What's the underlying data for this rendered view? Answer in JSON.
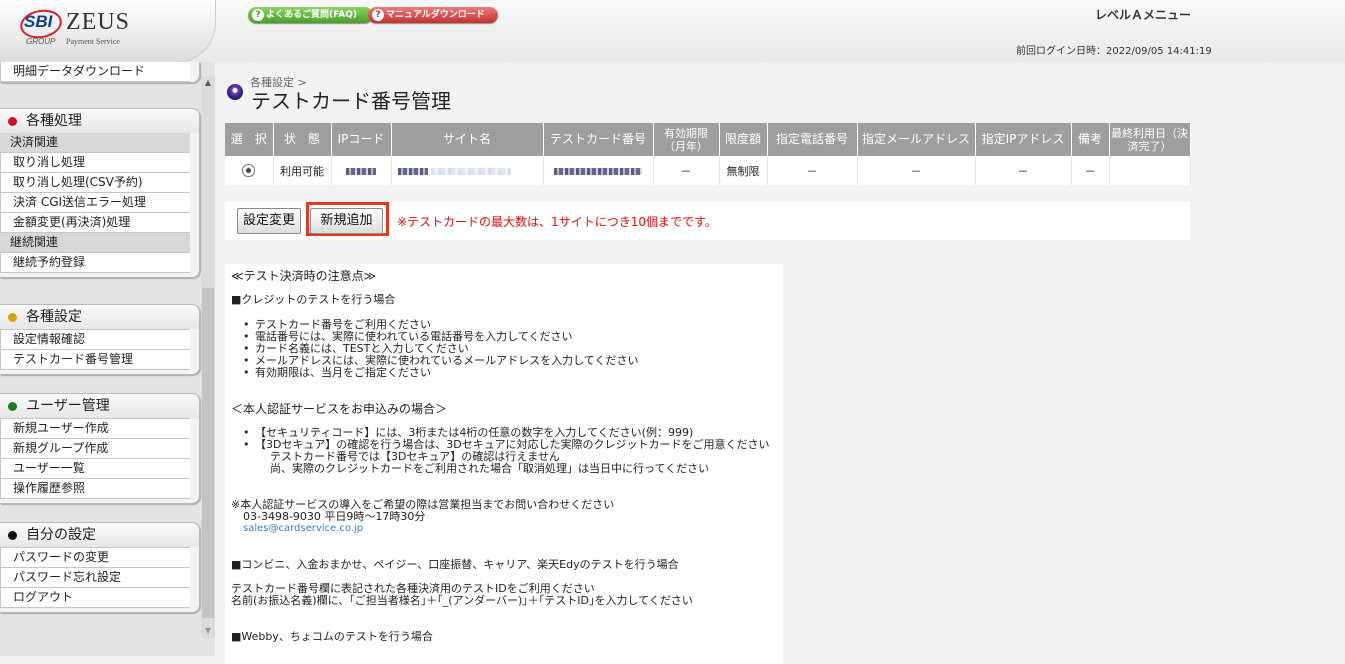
{
  "header": {
    "logo_sbi": "SBI",
    "logo_zeus": "ZEUS",
    "logo_group": "GROUP",
    "logo_payment": "Payment Service",
    "faq_label": "よくあるご質問(FAQ)",
    "manual_label": "マニュアルダウンロード",
    "level_menu": "レベルＡメニュー",
    "last_login": "前回ログイン日時：2022/09/05 14:41:19"
  },
  "sidebar": {
    "top_item": "明細データダウンロード",
    "sections": [
      {
        "title": "各種処理",
        "dot_color": "#c8102e"
      },
      {
        "title": "各種設定",
        "dot_color": "#d4a017"
      },
      {
        "title": "ユーザー管理",
        "dot_color": "#1e7a1e"
      },
      {
        "title": "自分の設定",
        "dot_color": "#111111"
      }
    ],
    "processing": {
      "sub1": "決済関連",
      "items1": [
        "取り消し処理",
        "取り消し処理(CSV予約)",
        "決済 CGI送信エラー処理",
        "金額変更(再決済)処理"
      ],
      "sub2": "継続関連",
      "items2": [
        "継続予約登録"
      ]
    },
    "settings_items": [
      "設定情報確認",
      "テストカード番号管理"
    ],
    "user_items": [
      "新規ユーザー作成",
      "新規グループ作成",
      "ユーザー一覧",
      "操作履歴参照"
    ],
    "self_items": [
      "パスワードの変更",
      "パスワード忘れ設定",
      "ログアウト"
    ]
  },
  "main": {
    "breadcrumb": "各種設定 >",
    "title": "テストカード番号管理",
    "table": {
      "headers": [
        "選　択",
        "状　態",
        "IPコード",
        "サイト名",
        "テストカード番号",
        "有効期限（月年）",
        "限度額",
        "指定電話番号",
        "指定メールアドレス",
        "指定IPアドレス",
        "備考",
        "最終利用日（決済完了）"
      ],
      "row": {
        "status": "利用可能",
        "expiry": "－",
        "limit": "無制限",
        "phone": "－",
        "email": "－",
        "ip": "－",
        "note": "－",
        "last_used": ""
      }
    },
    "buttons": {
      "setting_change": "設定変更",
      "add_new": "新規追加"
    },
    "max_note": "※テストカードの最大数は、1サイトにつき10個までです。",
    "notes": {
      "heading": "≪テスト決済時の注意点≫",
      "credit_title": "■クレジットのテストを行う場合",
      "credit_items": [
        "テストカード番号をご利用ください",
        "電話番号には、実際に使われている電話番号を入力してください",
        "カード名義には、TESTと入力してください",
        "メールアドレスには、実際に使われているメールアドレスを入力してください",
        "有効期限は、当月をご指定ください"
      ],
      "auth_title": "＜本人認証サービスをお申込みの場合＞",
      "auth_items": [
        "【セキュリティコード】には、3桁または4桁の任意の数字を入力してください(例：999)",
        "【3Dセキュア】の確認を行う場合は、3Dセキュアに対応した実際のクレジットカードをご用意ください"
      ],
      "auth_extra1": "テストカード番号では【3Dセキュア】の確認は行えません",
      "auth_extra2": "尚、実際のクレジットカードをご利用された場合「取消処理」は当日中に行ってください",
      "contact_title": "※本人認証サービスの導入をご希望の際は営業担当までお問い合わせください",
      "contact_phone": "03-3498-9030 平日9時～17時30分",
      "contact_email": "sales@cardservice.co.jp",
      "conv_title": "■コンビニ、入金おまかせ、ペイジー、口座振替、キャリア、楽天Edyのテストを行う場合",
      "conv_line1": "テストカード番号欄に表記された各種決済用のテストIDをご利用ください",
      "conv_line2": "名前(お振込名義)欄に、｢ご担当者様名｣＋｢_(アンダーバー)｣＋｢テストID｣を入力してください",
      "webby_title": "■Webby、ちょコムのテストを行う場合"
    }
  }
}
